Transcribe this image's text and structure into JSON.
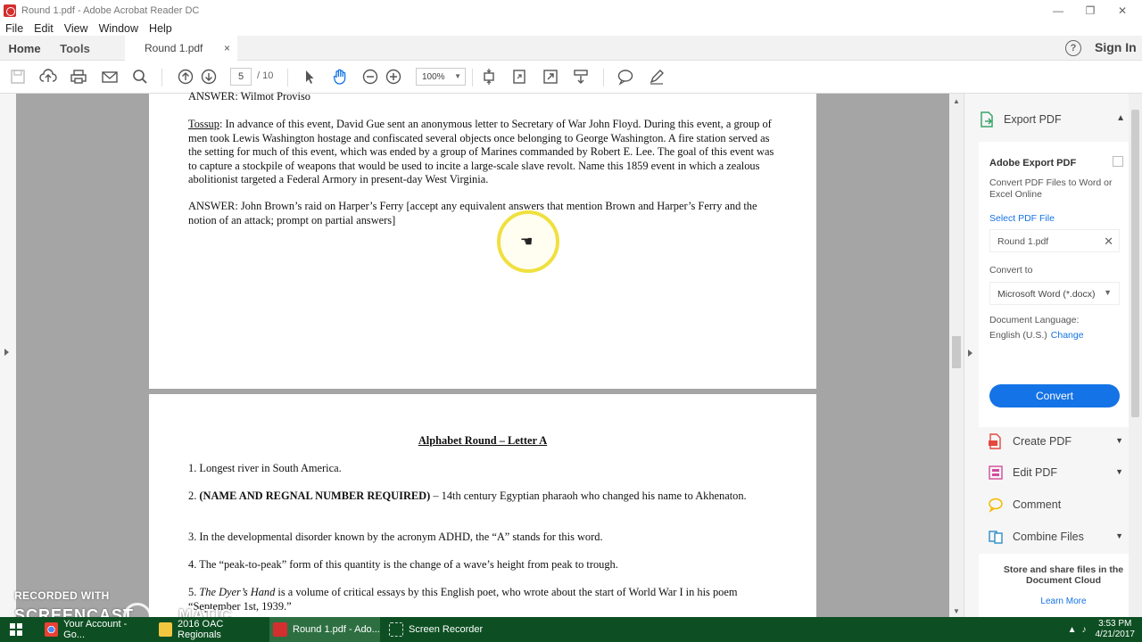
{
  "window": {
    "title": "Round 1.pdf - Adobe Acrobat Reader DC",
    "controls": [
      "—",
      "❐",
      "✕"
    ]
  },
  "menu": [
    "File",
    "Edit",
    "View",
    "Window",
    "Help"
  ],
  "tabs": {
    "home": "Home",
    "tools": "Tools",
    "document": "Round 1.pdf",
    "close": "×",
    "help": "?",
    "sign_in": "Sign In"
  },
  "toolbar": {
    "page_current": "5",
    "page_total": "/ 10",
    "zoom": "100%",
    "icons": [
      "save-icon",
      "upload-icon",
      "print-icon",
      "email-icon",
      "search-icon",
      "page-up-icon",
      "page-down-icon",
      "select-cursor-icon",
      "hand-tool-icon",
      "zoom-out-icon",
      "zoom-in-icon",
      "fit-page-icon",
      "rotate-icon",
      "full-screen-icon",
      "scroll-mode-icon",
      "comment-icon",
      "pen-icon"
    ]
  },
  "page1": {
    "answer_top": "ANSWER: Wilmot Proviso",
    "tossup_label": "Tossup",
    "tossup_text": ": In advance of this event, David Gue sent an anonymous letter to Secretary of War John Floyd.  During this event, a group of men took Lewis Washington hostage and confiscated several objects once belonging to George Washington.  A fire station served as the setting for much of this event, which was ended by a group of Marines commanded by Robert E. Lee.  The goal of this event was to capture a stockpile of weapons that would be used to incite a large-scale slave revolt.  Name this 1859 event in which a zealous abolitionist targeted a Federal Armory in present-day West Virginia.",
    "answer_line": "ANSWER: John Brown’s raid on Harper’s Ferry [accept any equivalent answers that mention Brown and Harper’s Ferry and the notion of an attack; prompt on partial answers]"
  },
  "page2": {
    "heading": "Alphabet Round – Letter A",
    "q1": "1. Longest river in South America.",
    "q2_bold": "(NAME AND REGNAL NUMBER REQUIRED)",
    "q2_prefix": "2. ",
    "q2_rest": " – 14th century Egyptian pharaoh who changed his name to Akhenaton.",
    "q3": "3. In the developmental disorder known by the acronym ADHD, the “A” stands for this word.",
    "q4": "4. The “peak-to-peak” form of this quantity is the change of a wave’s height from peak to trough.",
    "q5_prefix": "5. ",
    "q5_italic": "The Dyer’s Hand",
    "q5_rest": " is a volume of critical essays by this English poet, who wrote about the start of World War I in his poem “September 1st, 1939.”"
  },
  "right_panel": {
    "export_header": "Export PDF",
    "card_title": "Adobe Export PDF",
    "card_desc": "Convert PDF Files to Word or Excel Online",
    "select_file": "Select PDF File",
    "file_name": "Round 1.pdf",
    "convert_to_label": "Convert to",
    "format": "Microsoft Word (*.docx)",
    "doc_language_label": "Document Language:",
    "language": "English (U.S.)",
    "change": "Change",
    "convert_button": "Convert",
    "tools": [
      "Create PDF",
      "Edit PDF",
      "Comment",
      "Combine Files"
    ],
    "cloud_text": "Store and share files in the Document Cloud",
    "learn_more": "Learn More"
  },
  "taskbar": {
    "items": [
      "Your Account - Go...",
      "2016 OAC Regionals",
      "Round 1.pdf - Ado...",
      "Screen Recorder"
    ],
    "time": "3:53 PM",
    "date": "4/21/2017"
  },
  "watermark": {
    "line1": "RECORDED WITH",
    "line2": "SCREENCAST",
    "line3": "MATIC"
  },
  "colors": {
    "accent_blue": "#1473e6",
    "taskbar_green": "#0d4f22",
    "doc_gray": "#a5a5a5",
    "cursor_yellow": "#f0e040"
  }
}
